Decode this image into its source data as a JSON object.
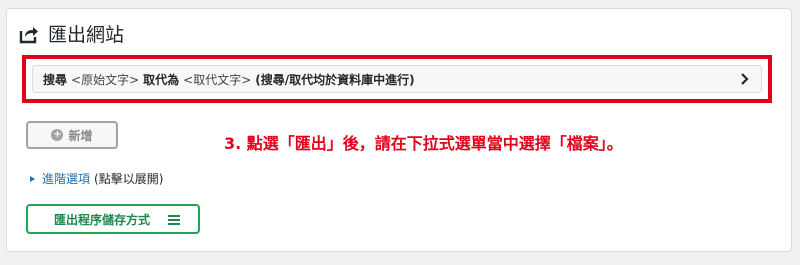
{
  "header": {
    "title": "匯出網站",
    "icon": "export-share-icon"
  },
  "search_replace": {
    "search_label": "搜尋",
    "original_placeholder": "<原始文字>",
    "replace_label": "取代為",
    "replacement_placeholder": "<取代文字>",
    "note": "(搜尋/取代均於資料庫中進行)",
    "icon": "chevron-right-icon"
  },
  "add_button": {
    "label": "新增",
    "icon": "plus-circle-icon"
  },
  "instruction": "3. 點選「匯出」後，請在下拉式選單當中選擇「檔案」。",
  "advanced": {
    "link_label": "進階選項",
    "hint": "(點擊以展開)",
    "icon": "caret-right-icon"
  },
  "method_button": {
    "label": "匯出程序儲存方式",
    "icon": "menu-lines-icon"
  },
  "colors": {
    "highlight_red": "#e3001b",
    "link_blue": "#2271b1",
    "success_green": "#21a35a"
  }
}
